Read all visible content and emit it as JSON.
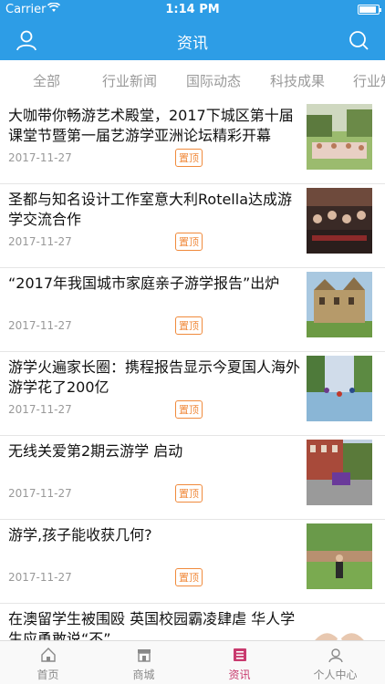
{
  "status_bar": {
    "carrier": "Carrier",
    "time": "1:14 PM",
    "battery_level": 0.9
  },
  "nav": {
    "title": "资讯",
    "left_icon": "user-icon",
    "right_icon": "search-icon"
  },
  "tabs": [
    {
      "label": "全部"
    },
    {
      "label": "行业新闻"
    },
    {
      "label": "国际动态"
    },
    {
      "label": "科技成果"
    },
    {
      "label": "行业知"
    }
  ],
  "articles": [
    {
      "title": "大咖带你畅游艺术殿堂，2017下城区第十届课堂节暨第一届艺游学亚洲论坛精彩开幕",
      "date": "2017-11-27",
      "badge": "置顶",
      "thumb_icon": "photo-icon"
    },
    {
      "title": "圣都与知名设计工作室意大利Rotella达成游学交流合作",
      "date": "2017-11-27",
      "badge": "置顶",
      "thumb_icon": "photo-icon"
    },
    {
      "title": "“2017年我国城市家庭亲子游学报告”出炉",
      "date": "2017-11-27",
      "badge": "置顶",
      "thumb_icon": "photo-icon"
    },
    {
      "title": "游学火遍家长圈：携程报告显示今夏国人海外游学花了200亿",
      "date": "2017-11-27",
      "badge": "置顶",
      "thumb_icon": "photo-icon"
    },
    {
      "title": "无线关爱第2期云游学 启动",
      "date": "2017-11-27",
      "badge": "置顶",
      "thumb_icon": "photo-icon"
    },
    {
      "title": "游学,孩子能收获几何?",
      "date": "2017-11-27",
      "badge": "置顶",
      "thumb_icon": "photo-icon"
    },
    {
      "title": "在澳留学生被围殴 英国校园霸凌肆虐 华人学生应勇敢说“不”",
      "date": "",
      "badge": "",
      "thumb_icon": "photo-icon"
    }
  ],
  "bottom_tabs": [
    {
      "label": "首页",
      "icon": "home-icon"
    },
    {
      "label": "商城",
      "icon": "store-icon"
    },
    {
      "label": "资讯",
      "icon": "news-icon",
      "active": true
    },
    {
      "label": "个人中心",
      "icon": "profile-icon"
    }
  ],
  "colors": {
    "primary": "#2d9de6",
    "badge": "#f08a3c",
    "active_tab": "#c83a6e"
  }
}
